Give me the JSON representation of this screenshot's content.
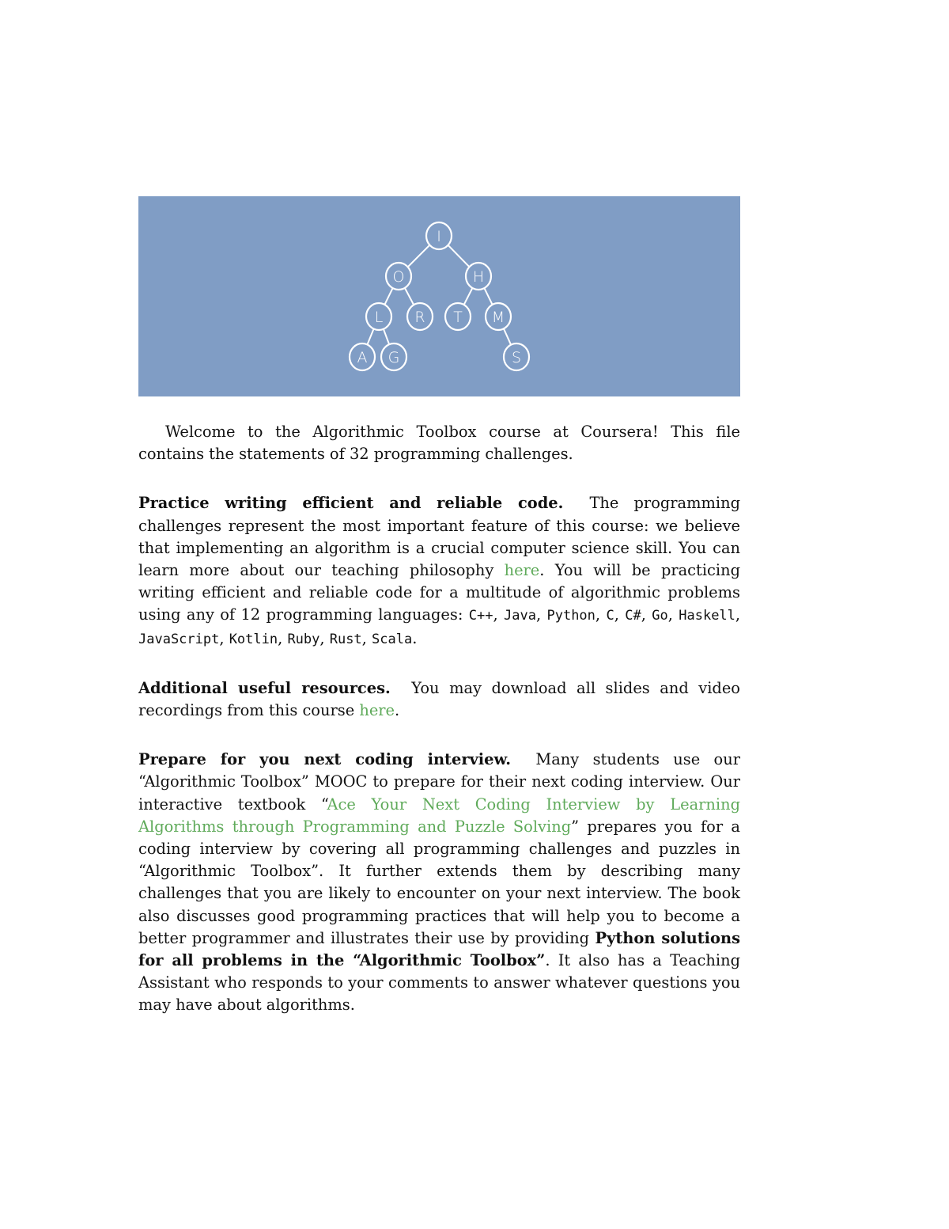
{
  "banner": {
    "background_color": "#809dc5",
    "tree": {
      "nodes": [
        {
          "id": "I",
          "label": "I"
        },
        {
          "id": "O",
          "label": "O"
        },
        {
          "id": "H",
          "label": "H"
        },
        {
          "id": "L",
          "label": "L"
        },
        {
          "id": "R",
          "label": "R"
        },
        {
          "id": "T",
          "label": "T"
        },
        {
          "id": "M",
          "label": "M"
        },
        {
          "id": "A",
          "label": "A"
        },
        {
          "id": "G",
          "label": "G"
        },
        {
          "id": "S",
          "label": "S"
        }
      ],
      "edges": [
        [
          "I",
          "O"
        ],
        [
          "I",
          "H"
        ],
        [
          "O",
          "L"
        ],
        [
          "O",
          "R"
        ],
        [
          "H",
          "T"
        ],
        [
          "H",
          "M"
        ],
        [
          "L",
          "A"
        ],
        [
          "L",
          "G"
        ],
        [
          "M",
          "S"
        ]
      ]
    }
  },
  "intro": {
    "text": "Welcome to the Algorithmic Toolbox course at Coursera!  This file contains the statements of 32 programming challenges."
  },
  "practice": {
    "heading": "Practice writing efficient and reliable code.",
    "text_before_link": "The programming challenges represent the most important feature of this course: we believe that implementing an algorithm is a crucial computer science skill. You can learn more about our teaching philosophy ",
    "link_label": "here",
    "text_after_link": ". You will be practicing writing efficient and reliable code for a multitude of algorithmic problems using any of 12 programming languages: ",
    "languages": [
      "C++",
      "Java",
      "Python",
      "C",
      "C#",
      "Go",
      "Haskell",
      "JavaScript",
      "Kotlin",
      "Ruby",
      "Rust",
      "Scala"
    ],
    "end": "."
  },
  "resources": {
    "heading": "Additional useful resources.",
    "text_before_link": "You may download all slides and video recordings from this course ",
    "link_label": "here",
    "end": "."
  },
  "interview": {
    "heading": "Prepare for you next coding interview.",
    "text1": "Many students use our “Algorithmic Toolbox” MOOC to prepare for their next coding interview. Our interactive textbook “",
    "book_link": "Ace Your Next Coding Interview by Learning Algorithms through Programming and Puzzle Solving",
    "text2": "” prepares you for a coding interview by covering all programming challenges and puzzles in “Algorithmic Toolbox”. It further extends them by describing many challenges that you are likely to encounter on your next interview. The book also discusses good programming practices that will help you to become a better programmer and illustrates their use by providing ",
    "bold_text": "Python solutions for all problems in the “Algorithmic Toolbox”",
    "text3": ". It also has a Teaching Assistant who responds to your comments to answer whatever questions you may have about algorithms."
  },
  "colors": {
    "link": "#5faa5a",
    "text": "#111111"
  }
}
